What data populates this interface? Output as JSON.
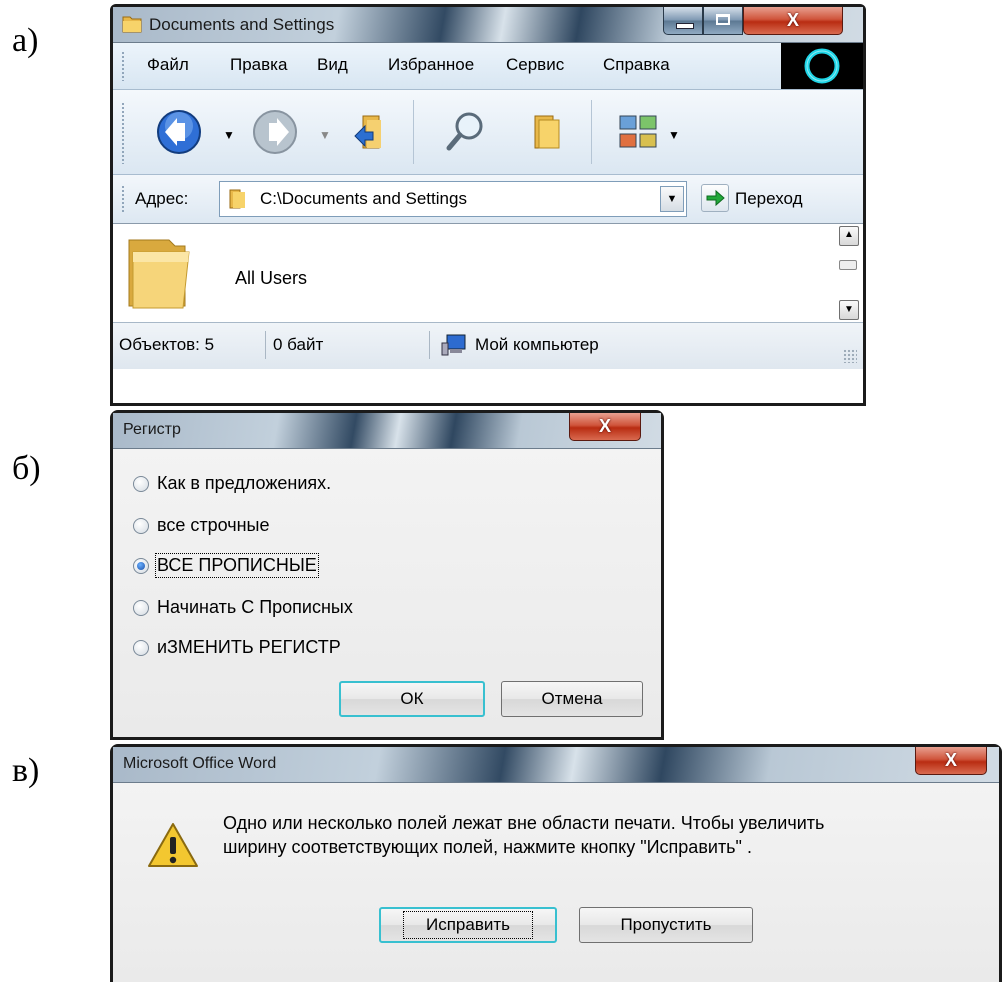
{
  "labels": {
    "a": "а)",
    "b": "б)",
    "c": "в)"
  },
  "explorer": {
    "title": "Documents and Settings",
    "menu": {
      "file": "Файл",
      "edit": "Правка",
      "view": "Вид",
      "favorites": "Избранное",
      "service": "Сервис",
      "help": "Справка"
    },
    "address": {
      "label": "Адрес:",
      "path": "C:\\Documents and Settings",
      "go": "Переход"
    },
    "items": [
      {
        "name": "All Users"
      }
    ],
    "status": {
      "objects": "Объектов: 5",
      "size": "0 байт",
      "location": "Мой компьютер"
    }
  },
  "register_dialog": {
    "title": "Регистр",
    "options": [
      {
        "label": "Как в предложениях.",
        "selected": false
      },
      {
        "label": "все строчные",
        "selected": false
      },
      {
        "label": "ВСЕ ПРОПИСНЫЕ",
        "selected": true
      },
      {
        "label": "Начинать С Прописных",
        "selected": false
      },
      {
        "label": "иЗМЕНИТЬ РЕГИСТР",
        "selected": false
      }
    ],
    "ok": "ОК",
    "cancel": "Отмена"
  },
  "word_dialog": {
    "title": "Microsoft Office Word",
    "message_line1": "Одно или несколько полей лежат вне области печати. Чтобы увеличить",
    "message_line2": "ширину соответствующих полей, нажмите кнопку \"Исправить\" .",
    "fix": "Исправить",
    "skip": "Пропустить"
  },
  "colors": {
    "accent_close": "#c8391c",
    "default_button_border": "#38c0d0",
    "toolbar_bg": "#dbe7f2"
  }
}
